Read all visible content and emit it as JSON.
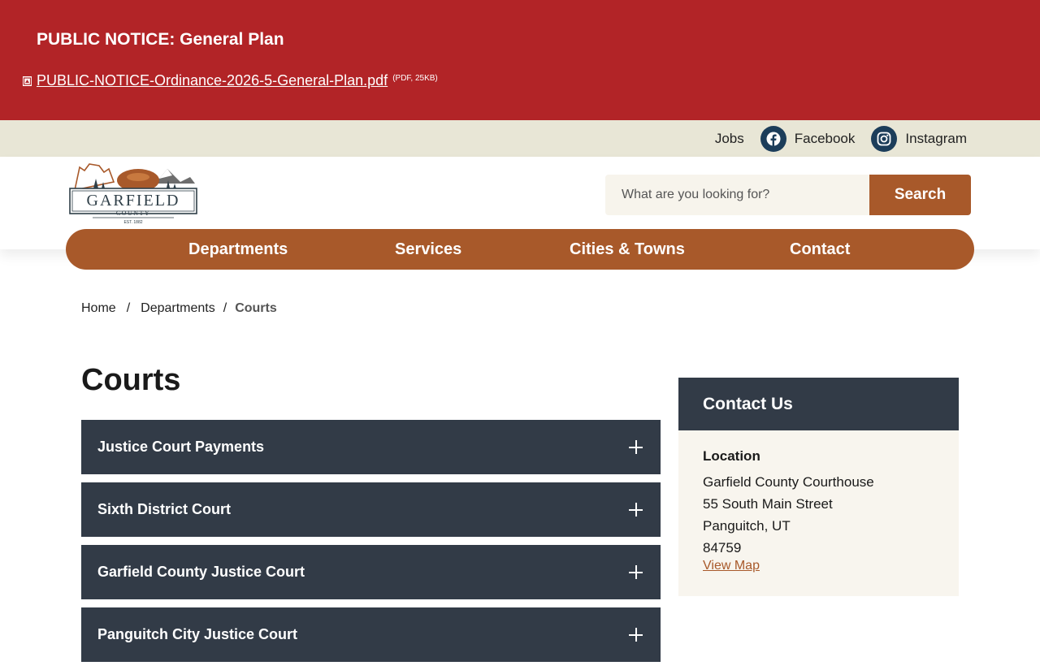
{
  "alert": {
    "title": "PUBLIC NOTICE: General Plan",
    "file_link": "PUBLIC-NOTICE-Ordinance-2026-5-General-Plan.pdf",
    "file_meta": "(PDF, 25KB)"
  },
  "utility": {
    "jobs": "Jobs",
    "facebook": "Facebook",
    "instagram": "Instagram"
  },
  "logo": {
    "name": "GARFIELD",
    "sub": "COUNTY",
    "est": "EST. 1882"
  },
  "search": {
    "placeholder": "What are you looking for?",
    "button": "Search"
  },
  "nav": {
    "items": [
      "Departments",
      "Services",
      "Cities & Towns",
      "Contact"
    ]
  },
  "breadcrumb": {
    "home": "Home",
    "departments": "Departments",
    "current": "Courts",
    "separator": "/"
  },
  "page": {
    "title": "Courts"
  },
  "accordion": {
    "items": [
      {
        "label": "Justice Court Payments"
      },
      {
        "label": "Sixth District Court"
      },
      {
        "label": "Garfield County Justice Court"
      },
      {
        "label": "Panguitch City Justice Court"
      }
    ]
  },
  "contact": {
    "title": "Contact Us",
    "location_label": "Location",
    "lines": [
      "Garfield County Courthouse",
      "55 South Main Street",
      "Panguitch, UT",
      "84759"
    ],
    "map_link": "View Map"
  },
  "colors": {
    "alert_bg": "#b22427",
    "utility_bg": "#e8e6d6",
    "brand_orange": "#a8592a",
    "slate": "#323b47",
    "social_blue": "#1c3d5a",
    "panel_bg": "#f8f5ee"
  }
}
